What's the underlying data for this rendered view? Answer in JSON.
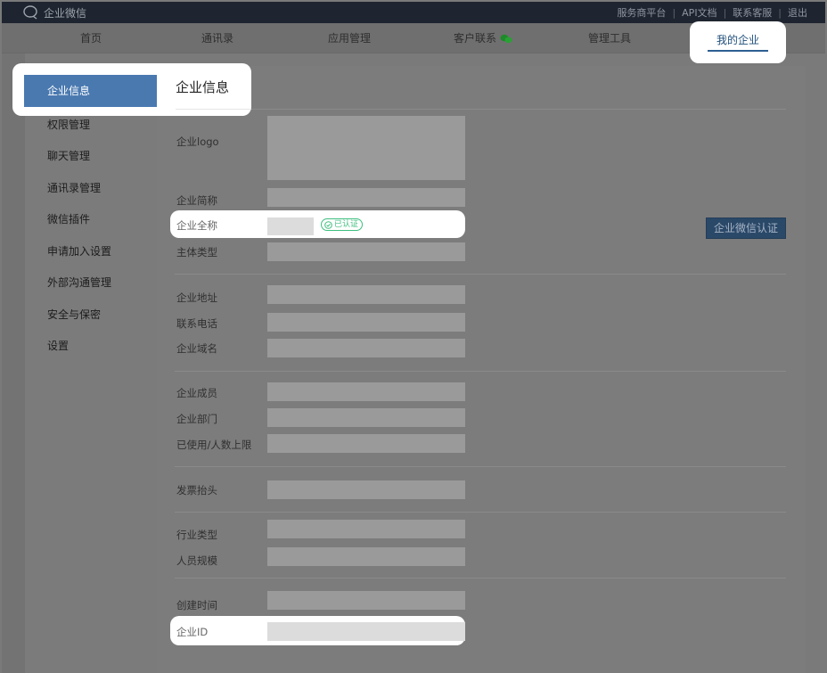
{
  "app": {
    "name": "企业微信"
  },
  "top_links": [
    "服务商平台",
    "API文档",
    "联系客服",
    "退出"
  ],
  "nav": {
    "items": [
      "首页",
      "通讯录",
      "应用管理",
      "客户联系",
      "管理工具"
    ],
    "active": "我的企业"
  },
  "sidebar": {
    "active": "企业信息",
    "items": [
      "权限管理",
      "聊天管理",
      "通讯录管理",
      "微信插件",
      "申请加入设置",
      "外部沟通管理",
      "安全与保密",
      "设置"
    ]
  },
  "main": {
    "title": "企业信息",
    "fields": {
      "logo": "企业logo",
      "short_name": "企业简称",
      "full_name": "企业全称",
      "subject_type": "主体类型",
      "address": "企业地址",
      "phone": "联系电话",
      "domain": "企业域名",
      "members": "企业成员",
      "departments": "企业部门",
      "usage_limit": "已使用/人数上限",
      "invoice": "发票抬头",
      "industry": "行业类型",
      "staff_size": "人员规模",
      "created": "创建时间",
      "corp_id": "企业ID"
    },
    "verified_badge": "已认证",
    "auth_button": "企业微信认证"
  },
  "colors": {
    "accent": "#4a79b0",
    "verified": "#3fbf7f",
    "topbar": "#1f2530"
  }
}
